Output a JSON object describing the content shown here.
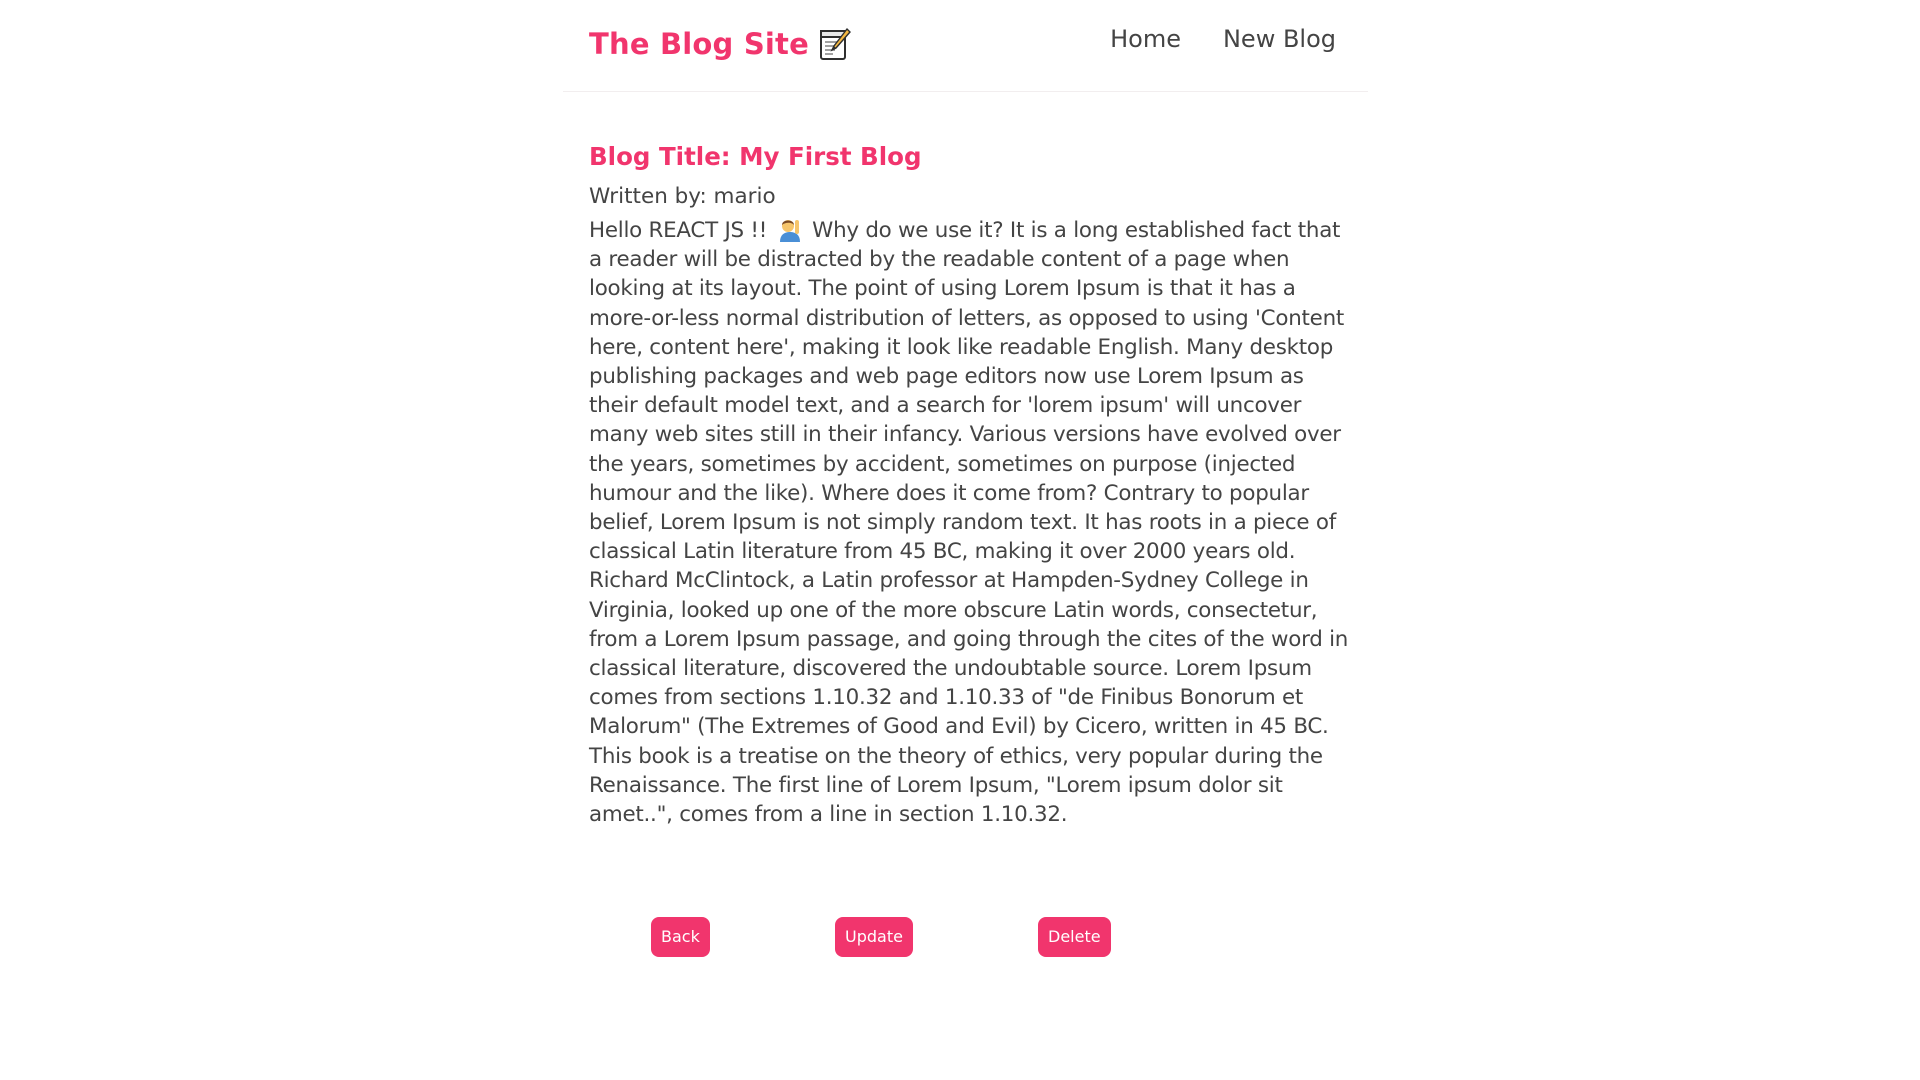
{
  "navbar": {
    "brand": "The Blog Site",
    "brand_icon": "memo-icon",
    "links": [
      "Home",
      "New Blog"
    ]
  },
  "blog": {
    "title": "Blog Title: My First Blog",
    "author": "Written by: mario",
    "body_start": "Hello REACT JS !!",
    "body_icon": "person-raising-hand-icon",
    "body_rest": "Why do we use it? It is a long established fact that a reader will be distracted by the readable content of a page when looking at its layout. The point of using Lorem Ipsum is that it has a more-or-less normal distribution of letters, as opposed to using 'Content here, content here', making it look like readable English. Many desktop publishing packages and web page editors now use Lorem Ipsum as their default model text, and a search for 'lorem ipsum' will uncover many web sites still in their infancy. Various versions have evolved over the years, sometimes by accident, sometimes on purpose (injected humour and the like). Where does it come from? Contrary to popular belief, Lorem Ipsum is not simply random text. It has roots in a piece of classical Latin literature from 45 BC, making it over 2000 years old. Richard McClintock, a Latin professor at Hampden-Sydney College in Virginia, looked up one of the more obscure Latin words, consectetur, from a Lorem Ipsum passage, and going through the cites of the word in classical literature, discovered the undoubtable source. Lorem Ipsum comes from sections 1.10.32 and 1.10.33 of \"de Finibus Bonorum et Malorum\" (The Extremes of Good and Evil) by Cicero, written in 45 BC. This book is a treatise on the theory of ethics, very popular during the Renaissance. The first line of Lorem Ipsum, \"Lorem ipsum dolor sit amet..\", comes from a line in section 1.10.32."
  },
  "buttons": {
    "back": "Back",
    "update": "Update",
    "delete": "Delete"
  },
  "colors": {
    "accent": "#f1356d",
    "text": "#444444"
  }
}
